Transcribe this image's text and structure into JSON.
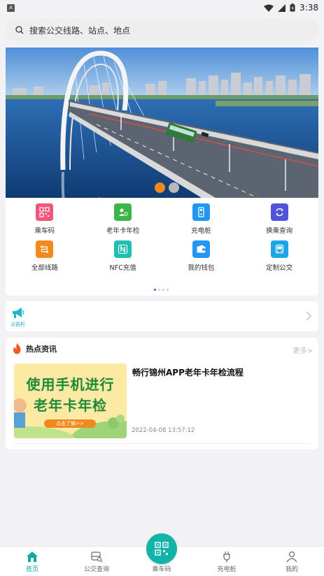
{
  "status_bar": {
    "time": "3:38",
    "app_badge": "A"
  },
  "search": {
    "placeholder": "搜索公交线路、站点、地点",
    "icon": "search-icon"
  },
  "banner": {
    "slide_count": 2,
    "active_index": 0
  },
  "menu": {
    "items": [
      {
        "label": "乘车码",
        "icon": "qr-bus-icon",
        "color": "#f0567a"
      },
      {
        "label": "老年卡年检",
        "icon": "senior-card-icon",
        "color": "#3cb648"
      },
      {
        "label": "充电桩",
        "icon": "charging-pile-icon",
        "color": "#2196f3"
      },
      {
        "label": "换乘查询",
        "icon": "transfer-icon",
        "color": "#4f55d8"
      },
      {
        "label": "全部线路",
        "icon": "all-routes-icon",
        "color": "#f08a1e"
      },
      {
        "label": "NFC充值",
        "icon": "nfc-icon",
        "color": "#1fbfb2"
      },
      {
        "label": "我的钱包",
        "icon": "wallet-icon",
        "color": "#2196f3"
      },
      {
        "label": "定制公交",
        "icon": "custom-bus-icon",
        "color": "#1ea5e8"
      }
    ],
    "page_count": 4,
    "active_page": 0
  },
  "notice": {
    "label": "公告栏",
    "icon": "megaphone-icon"
  },
  "news": {
    "title": "热点资讯",
    "more_label": "更多>",
    "items": [
      {
        "title": "畅行锦州APP老年卡年检流程",
        "date": "2022-04-08 13:57:12",
        "thumb_line1": "使用手机进行",
        "thumb_line2": "老年卡年检",
        "thumb_button": "点击了解>>"
      }
    ]
  },
  "tabbar": {
    "items": [
      {
        "label": "首页",
        "icon": "home-icon",
        "active": true
      },
      {
        "label": "公交查询",
        "icon": "bus-search-icon",
        "active": false
      },
      {
        "label": "乘车码",
        "icon": "qr-code-icon",
        "active": false
      },
      {
        "label": "充电桩",
        "icon": "plug-icon",
        "active": false
      },
      {
        "label": "我的",
        "icon": "user-icon",
        "active": false
      }
    ],
    "accent_color": "#13a9a0"
  }
}
